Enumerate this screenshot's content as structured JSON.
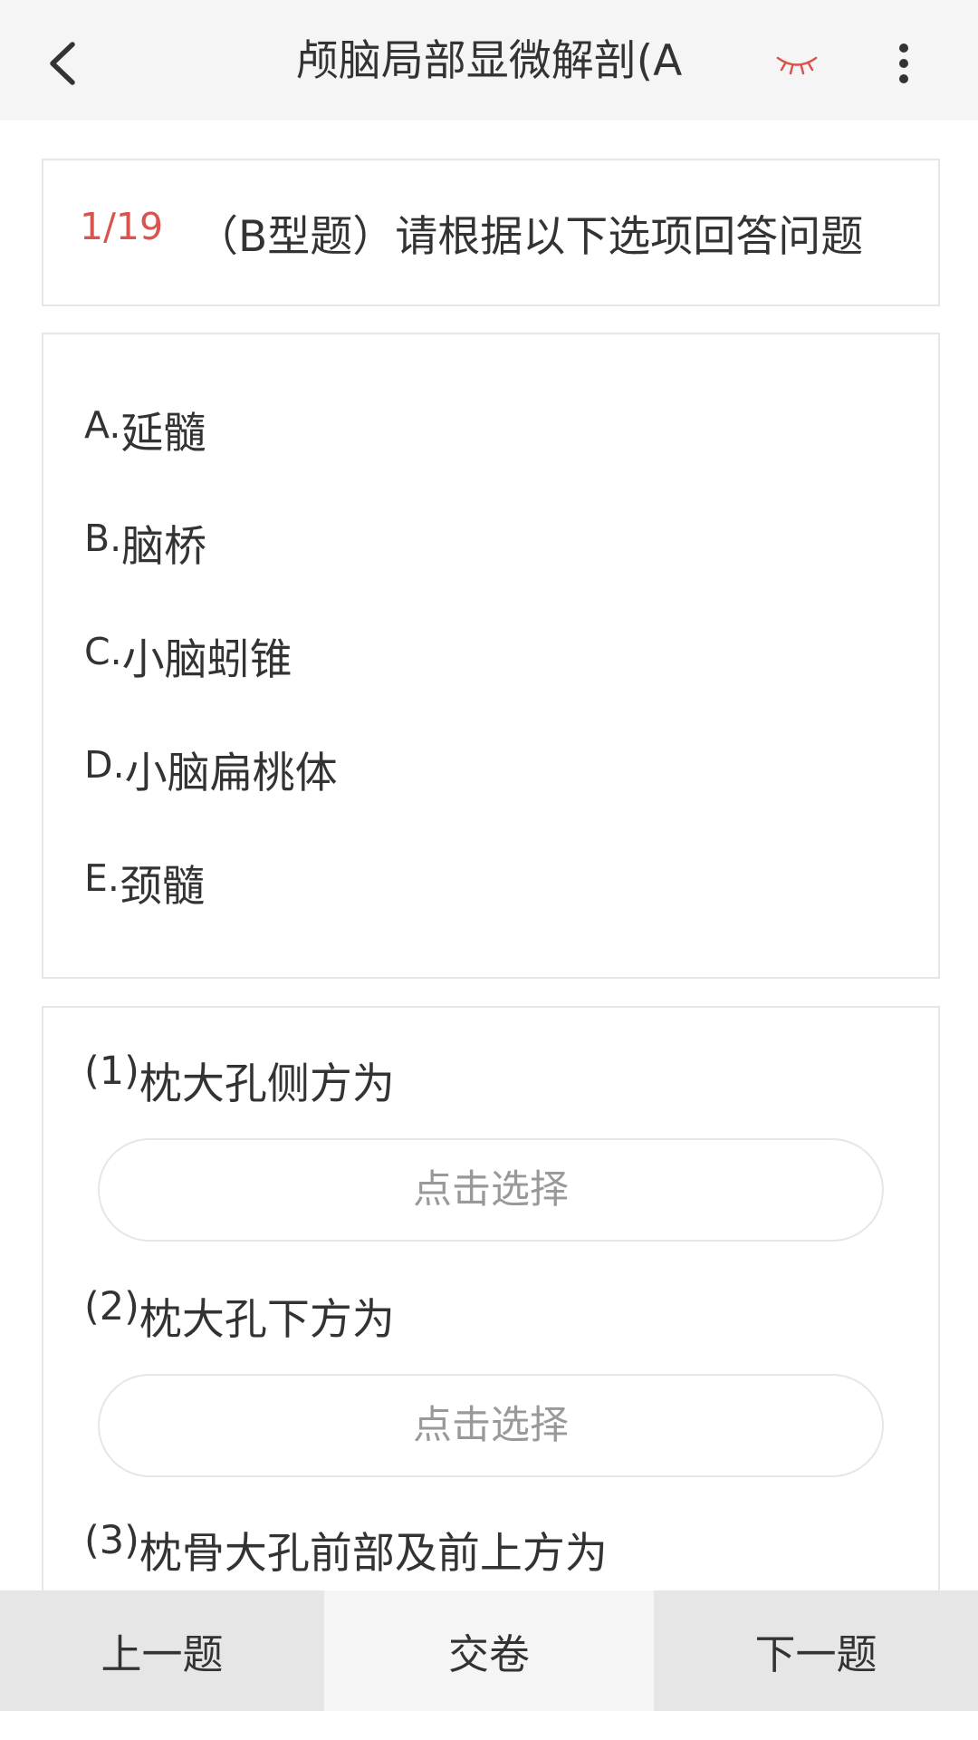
{
  "header": {
    "title": "颅脑局部显微解剖(A",
    "icons": {
      "back": "chevron-left-icon",
      "eye": "eye-closed-icon",
      "more": "more-vertical-icon"
    },
    "eye_color": "#d9534f"
  },
  "question": {
    "number": "1/19",
    "text": "（B型题）请根据以下选项回答问题"
  },
  "options": [
    {
      "letter": "A.",
      "text": "延髓"
    },
    {
      "letter": "B.",
      "text": "脑桥"
    },
    {
      "letter": "C.",
      "text": "小脑蚓锥"
    },
    {
      "letter": "D.",
      "text": "小脑扁桃体"
    },
    {
      "letter": "E.",
      "text": "颈髓"
    }
  ],
  "sub_questions": [
    {
      "number": "(1)",
      "text": "枕大孔侧方为",
      "select_label": "点击选择"
    },
    {
      "number": "(2)",
      "text": "枕大孔下方为",
      "select_label": "点击选择"
    },
    {
      "number": "(3)",
      "text": "枕骨大孔前部及前上方为"
    }
  ],
  "bottom_bar": {
    "prev_label": "上一题",
    "submit_label": "交卷",
    "next_label": "下一题"
  },
  "colors": {
    "accent_red": "#d9534f",
    "header_bg": "#f5f5f5",
    "border": "#e6e6e6",
    "placeholder_text": "#999999"
  }
}
